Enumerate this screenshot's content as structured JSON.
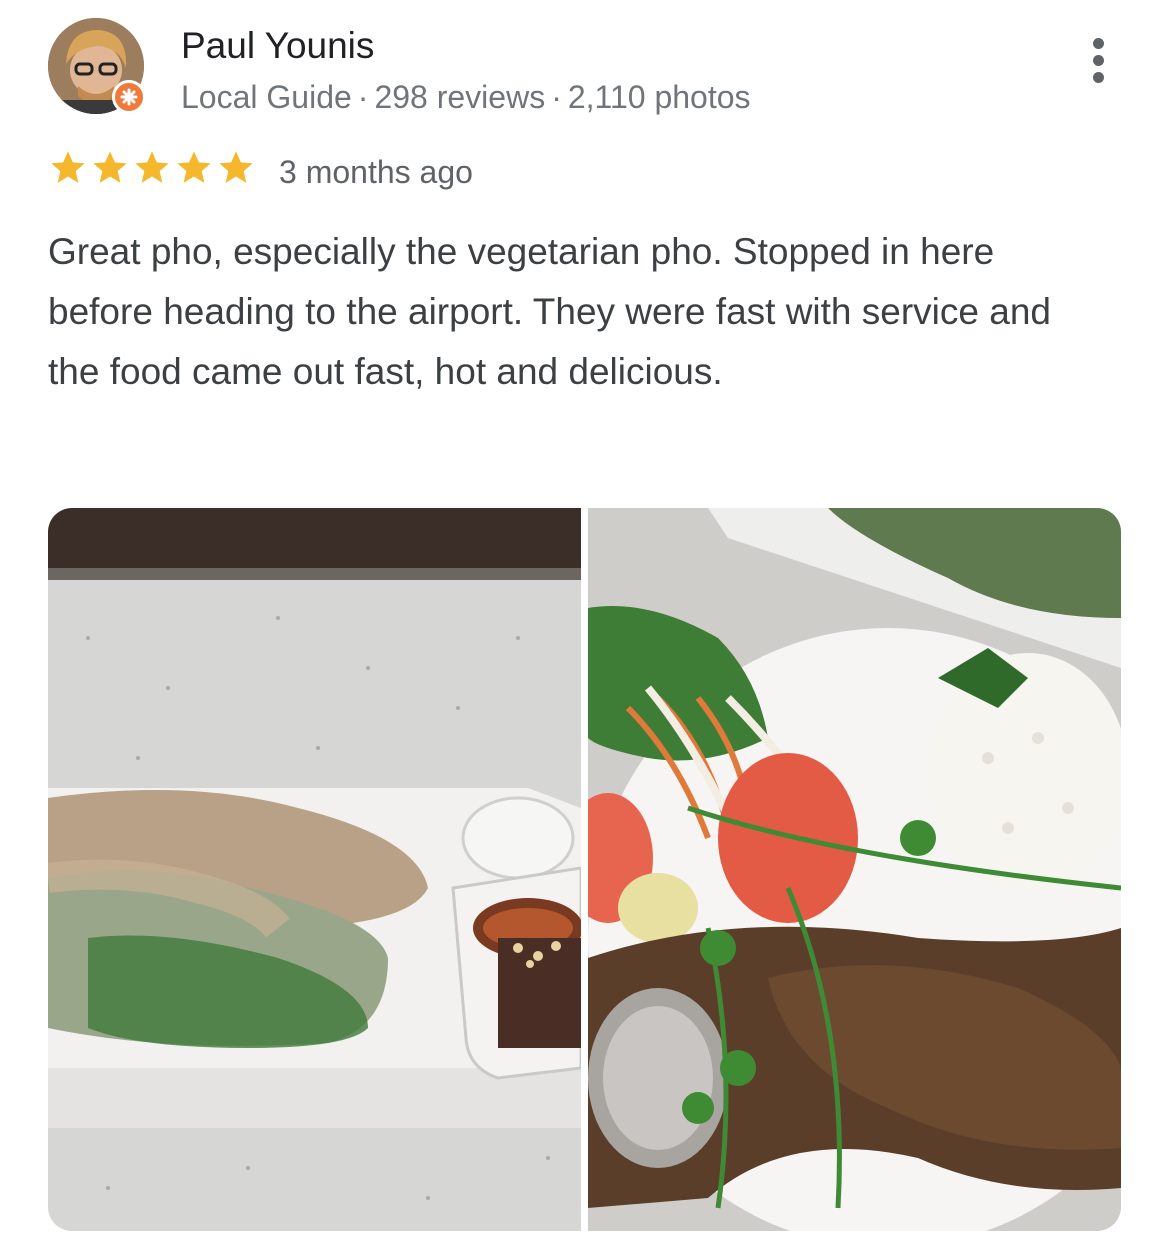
{
  "reviewer": {
    "name": "Paul Younis",
    "badge": "Local Guide",
    "reviews": "298 reviews",
    "photos": "2,110 photos",
    "separator": "·"
  },
  "review": {
    "rating": 5,
    "rating_max": 5,
    "time": "3 months ago",
    "text": "Great pho, especially the vegetarian pho. Stopped in here before heading to the airport. They were fast with service and the food came out fast, hot and delicious."
  },
  "icons": {
    "star": "star-icon",
    "more": "more-vert-icon",
    "local_guide": "local-guide-badge-icon"
  },
  "colors": {
    "star": "#f5b72b",
    "local_guide_badge": "#f07a3b"
  }
}
